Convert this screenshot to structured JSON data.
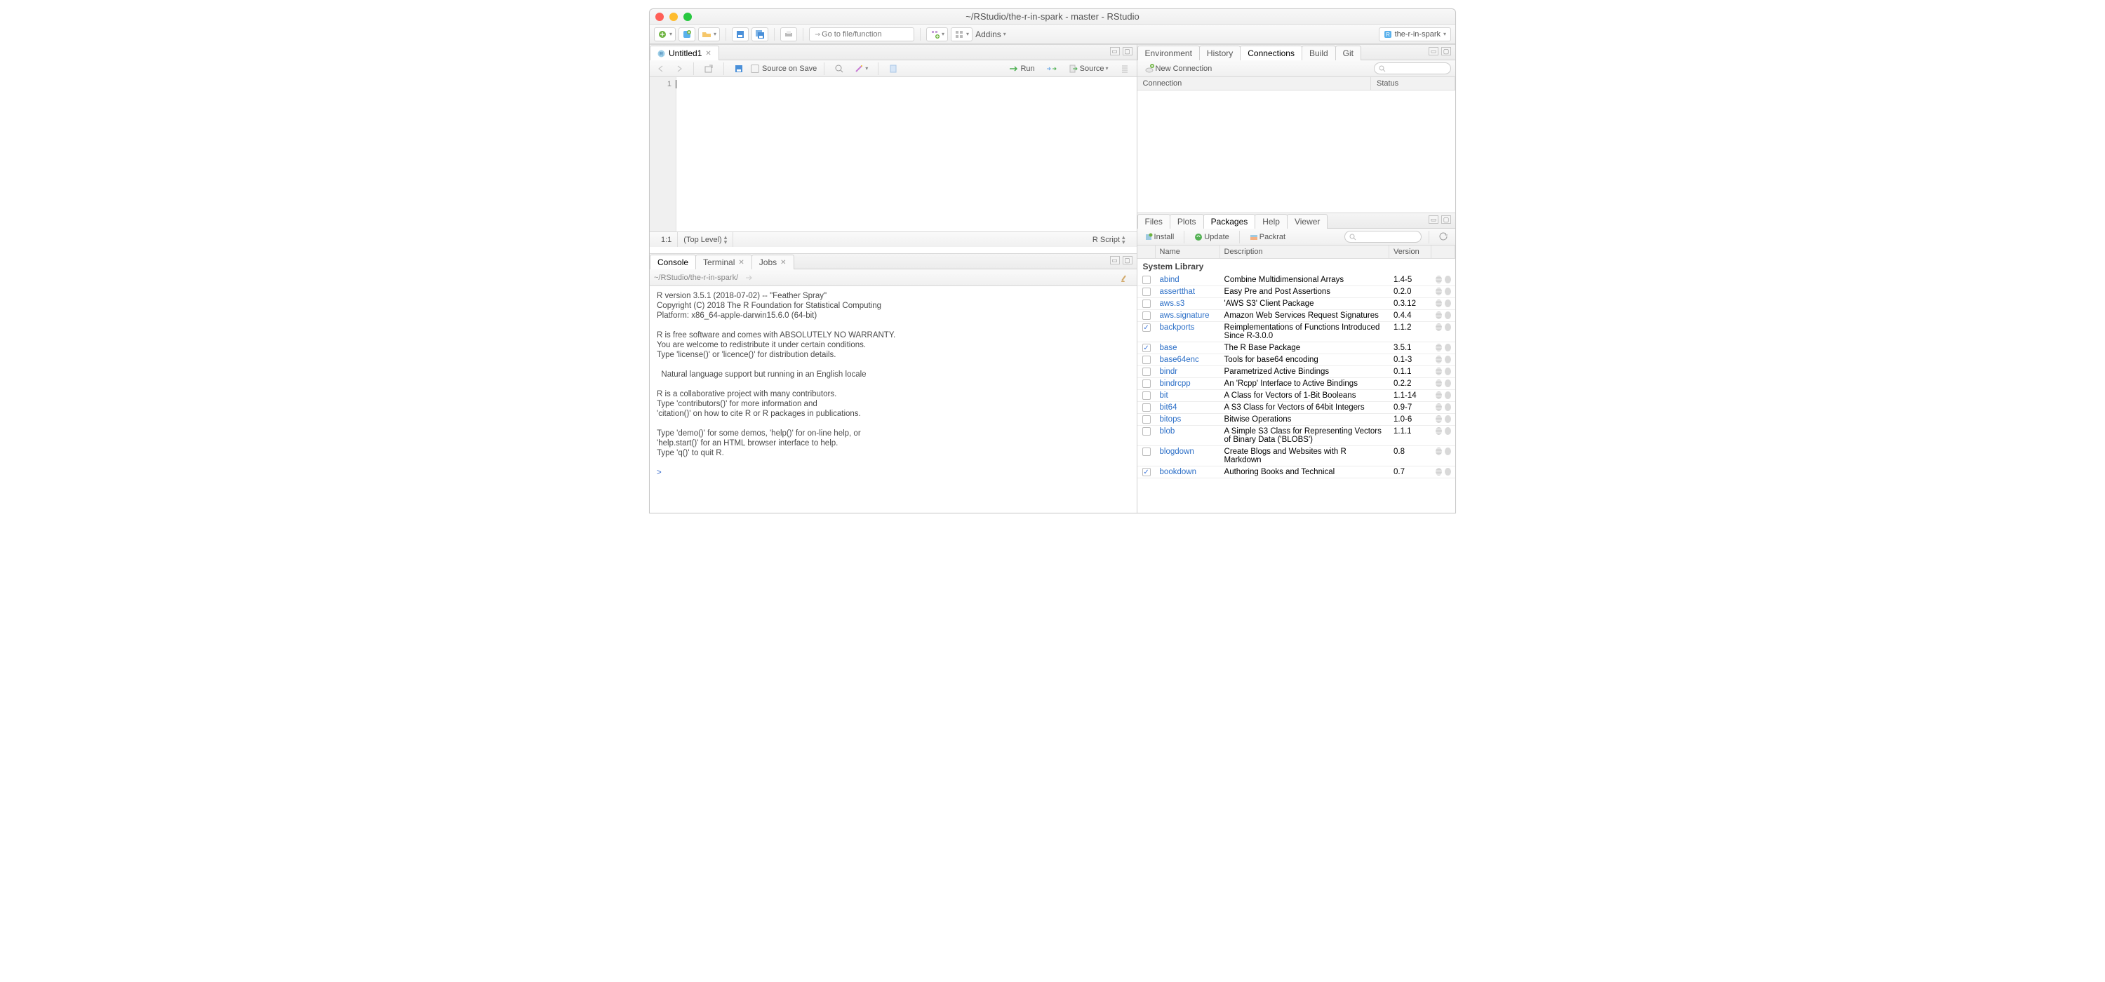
{
  "window": {
    "title": "~/RStudio/the-r-in-spark - master - RStudio"
  },
  "mainToolbar": {
    "goto_placeholder": "Go to file/function",
    "addins": "Addins",
    "project_name": "the-r-in-spark"
  },
  "source": {
    "tab_label": "Untitled1",
    "source_on_save": "Source on Save",
    "run": "Run",
    "source_btn": "Source",
    "gutter_line": "1",
    "status_pos": "1:1",
    "status_scope": "(Top Level)",
    "status_lang": "R Script"
  },
  "console": {
    "tabs": {
      "console": "Console",
      "terminal": "Terminal",
      "jobs": "Jobs"
    },
    "path": "~/RStudio/the-r-in-spark/",
    "body": "R version 3.5.1 (2018-07-02) -- \"Feather Spray\"\nCopyright (C) 2018 The R Foundation for Statistical Computing\nPlatform: x86_64-apple-darwin15.6.0 (64-bit)\n\nR is free software and comes with ABSOLUTELY NO WARRANTY.\nYou are welcome to redistribute it under certain conditions.\nType 'license()' or 'licence()' for distribution details.\n\n  Natural language support but running in an English locale\n\nR is a collaborative project with many contributors.\nType 'contributors()' for more information and\n'citation()' on how to cite R or R packages in publications.\n\nType 'demo()' for some demos, 'help()' for on-line help, or\n'help.start()' for an HTML browser interface to help.\nType 'q()' to quit R.\n",
    "prompt": ">"
  },
  "rightUpper": {
    "tabs": [
      "Environment",
      "History",
      "Connections",
      "Build",
      "Git"
    ],
    "active": "Connections",
    "new_connection": "New Connection",
    "col_connection": "Connection",
    "col_status": "Status"
  },
  "rightLower": {
    "tabs": [
      "Files",
      "Plots",
      "Packages",
      "Help",
      "Viewer"
    ],
    "active": "Packages",
    "install": "Install",
    "update": "Update",
    "packrat": "Packrat",
    "col_name": "Name",
    "col_desc": "Description",
    "col_ver": "Version",
    "group_label": "System Library",
    "packages": [
      {
        "checked": false,
        "name": "abind",
        "desc": "Combine Multidimensional Arrays",
        "ver": "1.4-5"
      },
      {
        "checked": false,
        "name": "assertthat",
        "desc": "Easy Pre and Post Assertions",
        "ver": "0.2.0"
      },
      {
        "checked": false,
        "name": "aws.s3",
        "desc": "'AWS S3' Client Package",
        "ver": "0.3.12"
      },
      {
        "checked": false,
        "name": "aws.signature",
        "desc": "Amazon Web Services Request Signatures",
        "ver": "0.4.4"
      },
      {
        "checked": true,
        "name": "backports",
        "desc": "Reimplementations of Functions Introduced Since R-3.0.0",
        "ver": "1.1.2"
      },
      {
        "checked": true,
        "name": "base",
        "desc": "The R Base Package",
        "ver": "3.5.1"
      },
      {
        "checked": false,
        "name": "base64enc",
        "desc": "Tools for base64 encoding",
        "ver": "0.1-3"
      },
      {
        "checked": false,
        "name": "bindr",
        "desc": "Parametrized Active Bindings",
        "ver": "0.1.1"
      },
      {
        "checked": false,
        "name": "bindrcpp",
        "desc": "An 'Rcpp' Interface to Active Bindings",
        "ver": "0.2.2"
      },
      {
        "checked": false,
        "name": "bit",
        "desc": "A Class for Vectors of 1-Bit Booleans",
        "ver": "1.1-14"
      },
      {
        "checked": false,
        "name": "bit64",
        "desc": "A S3 Class for Vectors of 64bit Integers",
        "ver": "0.9-7"
      },
      {
        "checked": false,
        "name": "bitops",
        "desc": "Bitwise Operations",
        "ver": "1.0-6"
      },
      {
        "checked": false,
        "name": "blob",
        "desc": "A Simple S3 Class for Representing Vectors of Binary Data ('BLOBS')",
        "ver": "1.1.1"
      },
      {
        "checked": false,
        "name": "blogdown",
        "desc": "Create Blogs and Websites with R Markdown",
        "ver": "0.8"
      },
      {
        "checked": true,
        "name": "bookdown",
        "desc": "Authoring Books and Technical",
        "ver": "0.7"
      }
    ]
  }
}
